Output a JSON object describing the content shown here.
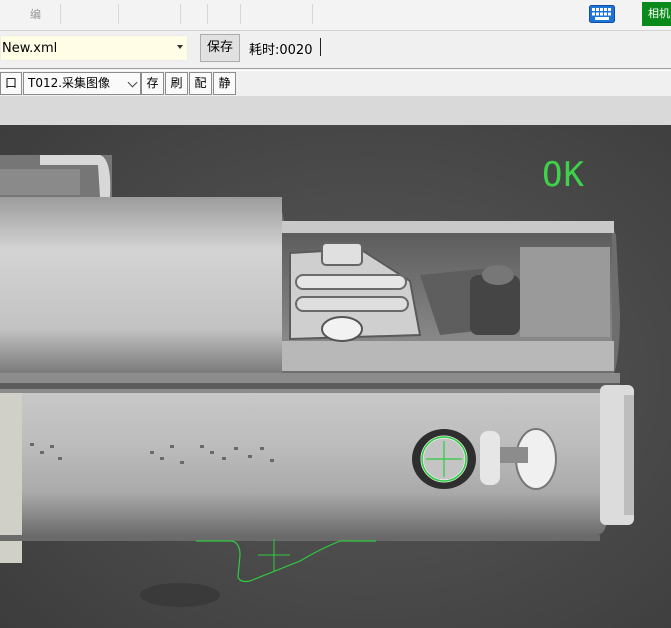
{
  "menubar": {
    "items": [
      "编",
      "",
      "",
      "",
      "",
      "",
      "",
      "",
      "",
      ""
    ],
    "camera_label": "相机"
  },
  "filerow": {
    "file_name": "New.xml",
    "save_label": "保存",
    "elapsed_label": "耗时:",
    "elapsed_value": "0020"
  },
  "toolrow": {
    "square_label": "口",
    "step_select": "T012.采集图像",
    "store_label": "存",
    "refresh_label": "刷",
    "config_label": "配",
    "static_label": "静"
  },
  "viewport": {
    "status": "OK",
    "status_color": "#3ed24a",
    "overlay_color": "#2ecc40"
  }
}
